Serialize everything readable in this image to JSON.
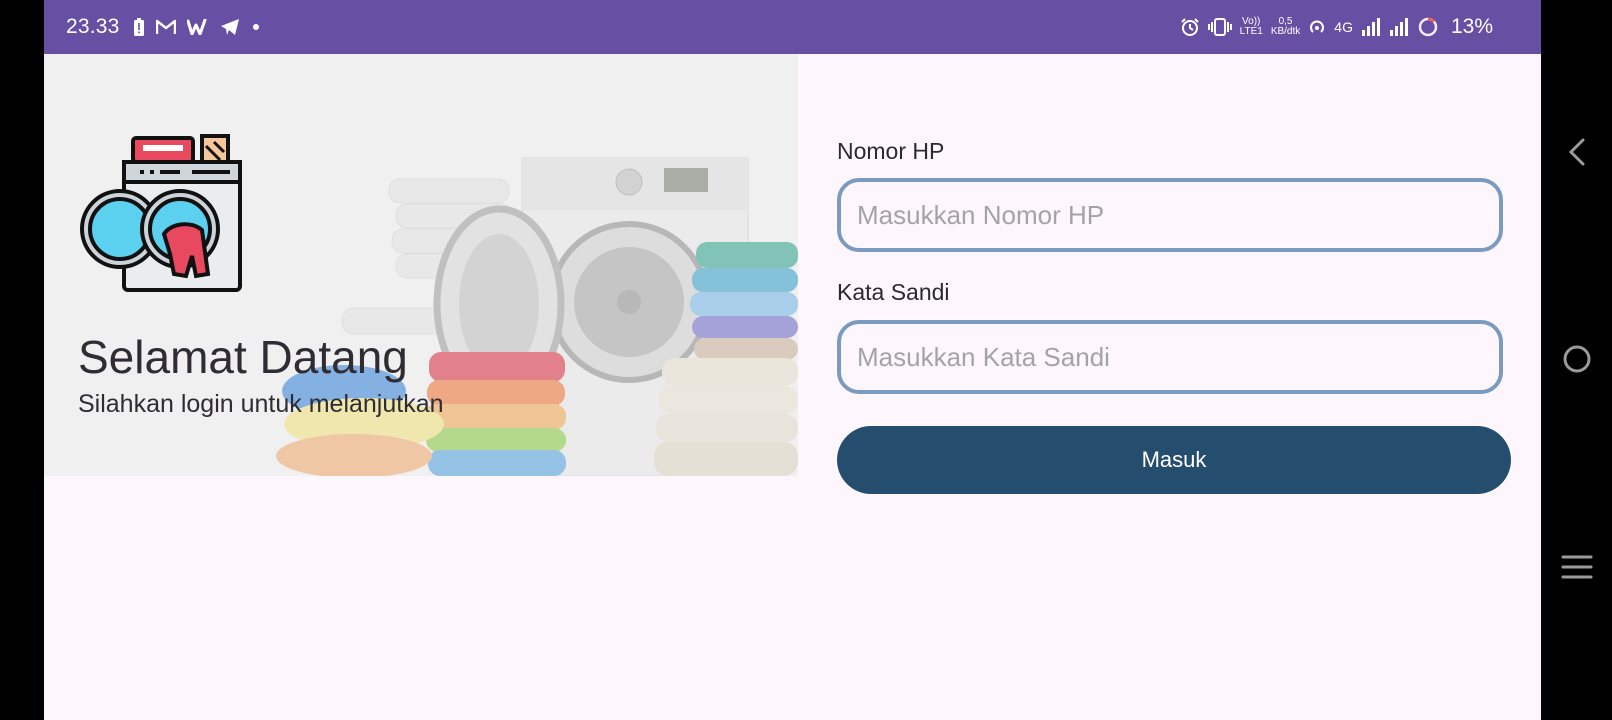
{
  "status_bar": {
    "time": "23.33",
    "data_speed_value": "0,5",
    "data_speed_unit": "KB/dtk",
    "volte_top": "Vo))",
    "volte_bottom": "LTE1",
    "network_type": "4G",
    "battery_percent": "13%",
    "left_icons": [
      "battery-alert-icon",
      "gmail-icon",
      "w-app-icon",
      "telegram-icon",
      "more-dot-icon"
    ],
    "right_icons": [
      "alarm-icon",
      "vibrate-icon",
      "volte-icon",
      "data-speed-icon",
      "hotspot-icon",
      "signal-icon",
      "signal-icon",
      "battery-ring-icon"
    ]
  },
  "hero": {
    "title": "Selamat Datang",
    "subtitle": "Silahkan login untuk melanjutkan",
    "logo_icon": "washing-machine-icon",
    "background_icon": "laundry-scene-illustration"
  },
  "login_form": {
    "phone": {
      "label": "Nomor HP",
      "placeholder": "Masukkan Nomor HP",
      "value": ""
    },
    "password": {
      "label": "Kata Sandi",
      "placeholder": "Masukkan Kata Sandi",
      "value": ""
    },
    "submit_label": "Masuk"
  },
  "navigation_bar": {
    "buttons": [
      "back-icon",
      "home-icon",
      "menu-icon"
    ]
  },
  "colors": {
    "status_bar": "#6750a4",
    "background": "#fdf7fd",
    "input_border": "#7b9abf",
    "button": "#254e6e",
    "text": "#2f2d33"
  }
}
